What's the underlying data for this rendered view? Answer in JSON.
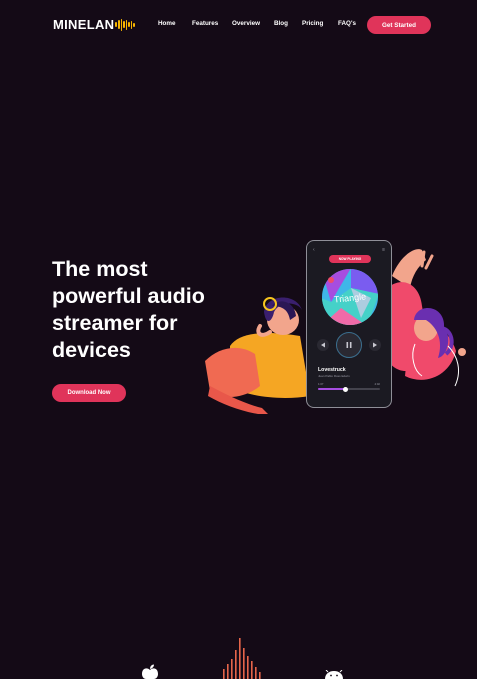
{
  "brand": {
    "logo_text": "MINELAN",
    "logo_wave_icon": "sound-wave-icon",
    "accent": "#e0345a",
    "wave_color": "#f7b500",
    "background": "#140a16"
  },
  "nav": {
    "items": [
      {
        "label": "Home"
      },
      {
        "label": "Features"
      },
      {
        "label": "Overview"
      },
      {
        "label": "Blog"
      },
      {
        "label": "Pricing"
      },
      {
        "label": "FAQ's"
      }
    ],
    "cta_label": "Get Started"
  },
  "hero": {
    "title_lines": [
      "The most",
      "powerful audio",
      "streamer for",
      "devices"
    ],
    "download_label": "Download Now"
  },
  "phone": {
    "badge": "NOW PLAYING",
    "album_title": "Triangle",
    "track_name": "Lovestruck",
    "track_artist": "Juan Pablo Ross Edwin",
    "time_elapsed": "1:07",
    "time_total": "4:02",
    "progress": 0.45,
    "back_icon": "chevron-left-icon",
    "menu_icon": "menu-icon",
    "prev_icon": "previous-icon",
    "play_icon": "play-pause-icon",
    "next_icon": "next-icon"
  },
  "bottom": {
    "icons": [
      "apple-icon",
      "equalizer-bars-icon",
      "android-icon"
    ]
  }
}
